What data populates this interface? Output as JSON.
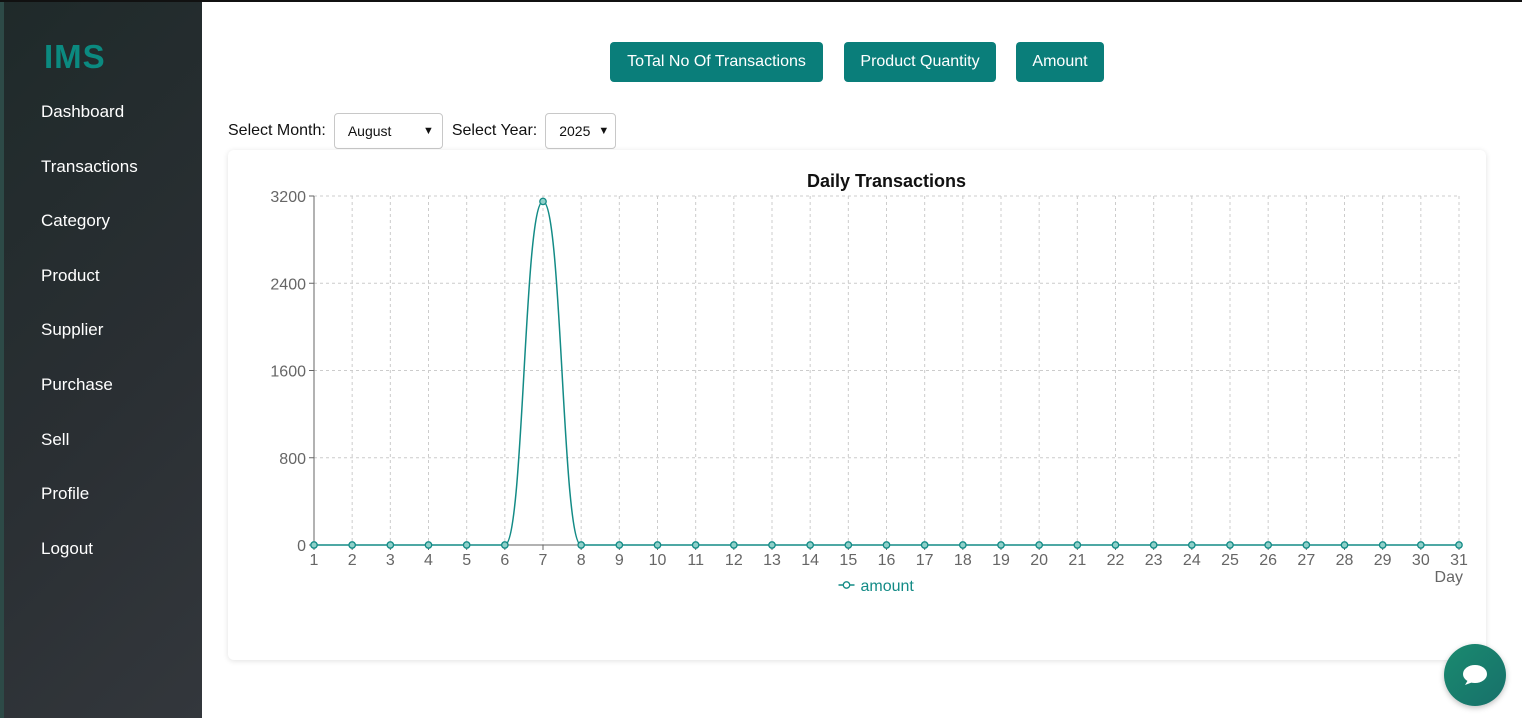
{
  "app": {
    "logo": "IMS"
  },
  "sidebar": {
    "items": [
      {
        "label": "Dashboard"
      },
      {
        "label": "Transactions"
      },
      {
        "label": "Category"
      },
      {
        "label": "Product"
      },
      {
        "label": "Supplier"
      },
      {
        "label": "Purchase"
      },
      {
        "label": "Sell"
      },
      {
        "label": "Profile"
      },
      {
        "label": "Logout"
      }
    ]
  },
  "toolbar": {
    "total_label": "ToTal No Of Transactions",
    "quantity_label": "Product Quantity",
    "amount_label": "Amount"
  },
  "filters": {
    "month_label": "Select Month:",
    "month_value": "August",
    "year_label": "Select Year:",
    "year_value": "2025"
  },
  "colors": {
    "accent": "#0a7e7a",
    "line": "#138b86",
    "grid": "#cccccc"
  },
  "chart_data": {
    "type": "line",
    "title": "Daily Transactions",
    "xlabel": "Day",
    "ylabel": "",
    "x": [
      1,
      2,
      3,
      4,
      5,
      6,
      7,
      8,
      9,
      10,
      11,
      12,
      13,
      14,
      15,
      16,
      17,
      18,
      19,
      20,
      21,
      22,
      23,
      24,
      25,
      26,
      27,
      28,
      29,
      30,
      31
    ],
    "series": [
      {
        "name": "amount",
        "values": [
          0,
          0,
          0,
          0,
          0,
          0,
          3150,
          0,
          0,
          0,
          0,
          0,
          0,
          0,
          0,
          0,
          0,
          0,
          0,
          0,
          0,
          0,
          0,
          0,
          0,
          0,
          0,
          0,
          0,
          0,
          0
        ]
      }
    ],
    "ylim": [
      0,
      3200
    ],
    "yticks": [
      0,
      800,
      1600,
      2400,
      3200
    ],
    "grid": true,
    "legend": "bottom"
  },
  "chat": {
    "icon": "chat-bubble-icon"
  }
}
